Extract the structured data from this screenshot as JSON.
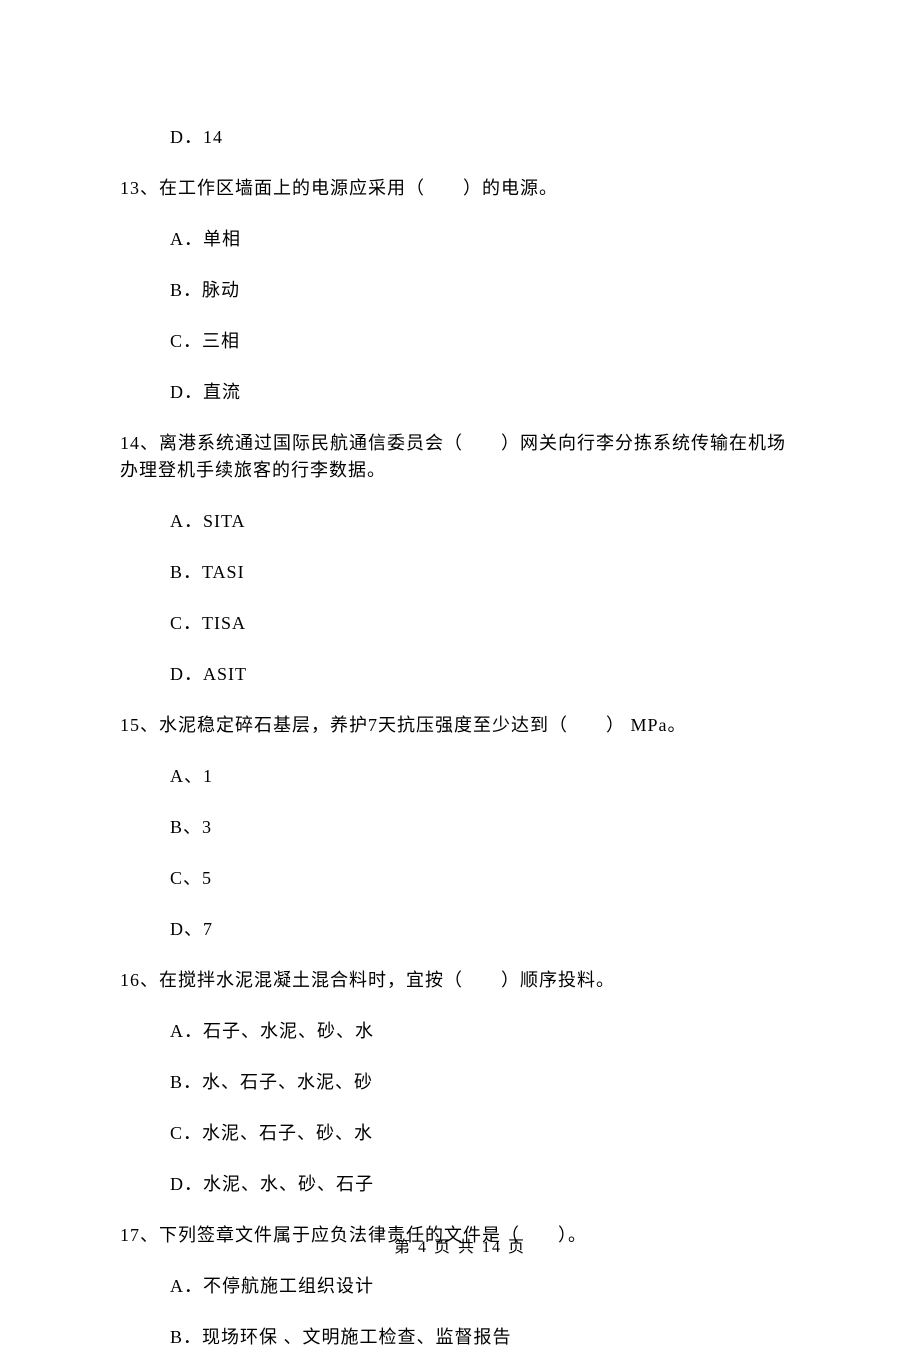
{
  "options_pre": [
    "D．14"
  ],
  "questions": [
    {
      "stem": "13、在工作区墙面上的电源应采用（　　）的电源。",
      "options": [
        "A．单相",
        "B．脉动",
        "C．三相",
        "D．直流"
      ]
    },
    {
      "stem": "14、离港系统通过国际民航通信委员会（　　）网关向行李分拣系统传输在机场办理登机手续旅客的行李数据。",
      "options": [
        "A．SITA",
        "B．TASI",
        "C．TISA",
        "D．ASIT"
      ]
    },
    {
      "stem": "15、水泥稳定碎石基层，养护7天抗压强度至少达到（　　） MPa。",
      "options": [
        "A、1",
        "B、3",
        "C、5",
        "D、7"
      ]
    },
    {
      "stem": "16、在搅拌水泥混凝土混合料时，宜按（　　）顺序投料。",
      "options": [
        "A．石子、水泥、砂、水",
        "B．水、石子、水泥、砂",
        "C．水泥、石子、砂、水",
        "D．水泥、水、砂、石子"
      ]
    },
    {
      "stem": "17、下列签章文件属于应负法律责任的文件是（　　）。",
      "options": [
        "A．不停航施工组织设计",
        "B．现场环保 、文明施工检查、监督报告"
      ]
    }
  ],
  "footer": "第 4 页 共 14 页"
}
